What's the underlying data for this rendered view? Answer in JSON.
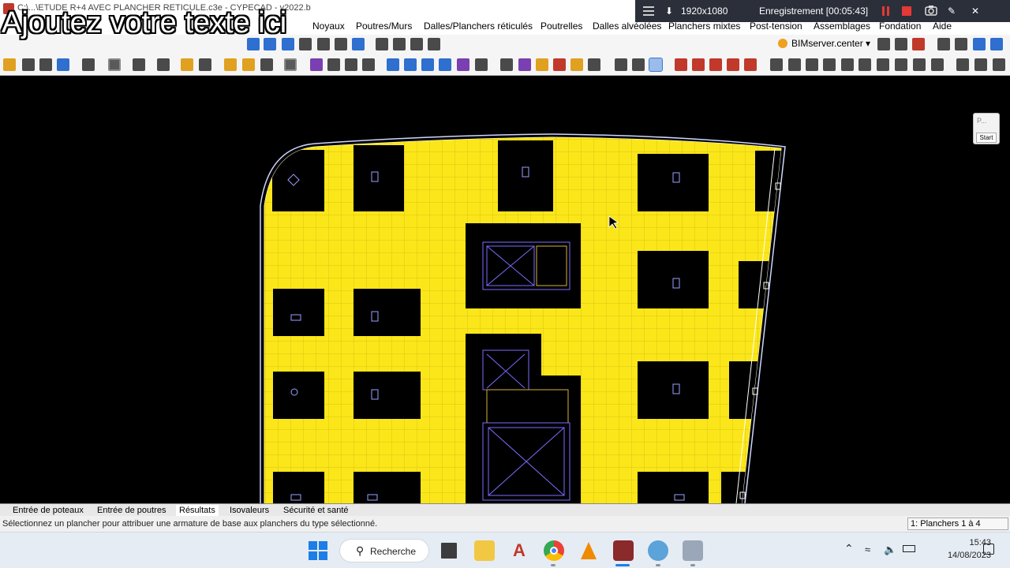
{
  "window": {
    "title": "C:\\...\\ETUDE R+4 AVEC PLANCHER RETICULE.c3e - CYPECAD - v2022.b",
    "overlay_text": "Ajoutez votre texte ici"
  },
  "recorder": {
    "resolution": "1920x1080",
    "recording_label": "Enregistrement [00:05:43]"
  },
  "menu": {
    "items": [
      "Noyaux",
      "Poutres/Murs",
      "Dalles/Planchers réticulés",
      "Poutrelles",
      "Dalles alvéolées",
      "Planchers mixtes",
      "Post-tension",
      "Assemblages",
      "Fondation",
      "Aide"
    ]
  },
  "toolbar": {
    "bimserver_label": "BIMserver.center ▾"
  },
  "start_panel": {
    "p_label": "P...",
    "start_label": "Start"
  },
  "tabs": [
    {
      "label": "Entrée de poteaux",
      "active": false
    },
    {
      "label": "Entrée de poutres",
      "active": false
    },
    {
      "label": "Résultats",
      "active": true
    },
    {
      "label": "Isovaleurs",
      "active": false
    },
    {
      "label": "Sécurité et santé",
      "active": false
    }
  ],
  "status": {
    "message": "Sélectionnez un plancher pour attribuer une armature de base aux planchers du type sélectionné.",
    "floor": "1: Planchers 1 à 4"
  },
  "taskbar": {
    "search_label": "Recherche",
    "time": "15:43",
    "date": "14/08/2023"
  },
  "colors": {
    "slab": "#fbe61a",
    "slab_grid": "#d8c510",
    "void": "#000000",
    "canvas_bg": "#000000",
    "detail_lines": "#6a5acd"
  }
}
